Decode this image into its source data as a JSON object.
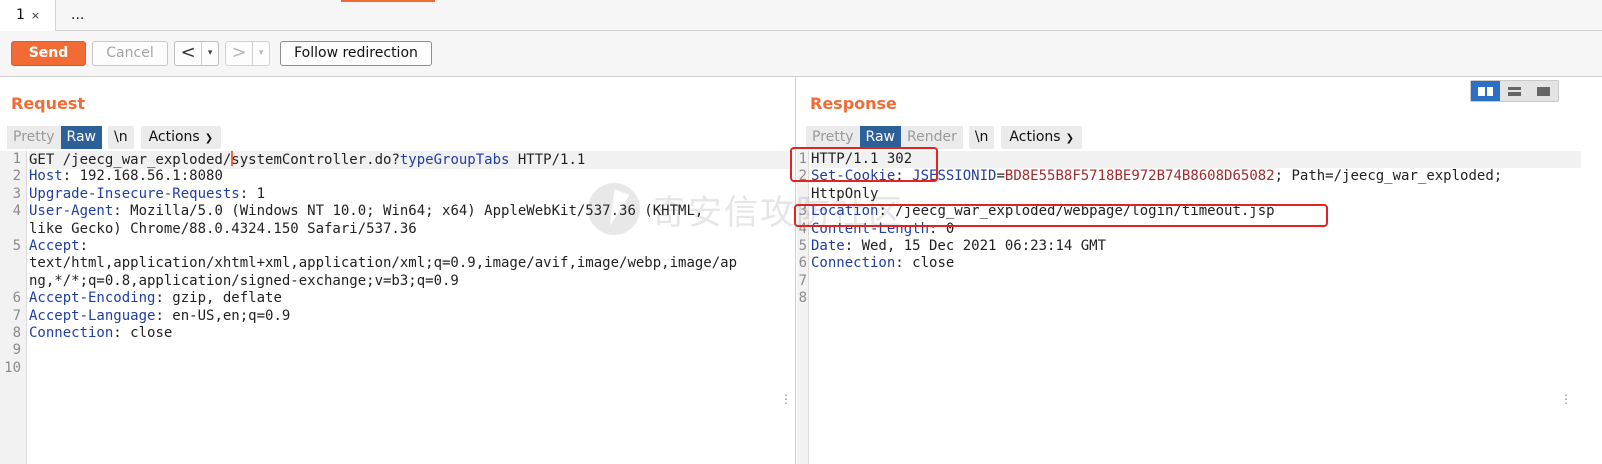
{
  "tabs": [
    {
      "label": "1",
      "close": "×"
    },
    {
      "label": "..."
    }
  ],
  "toolbar": {
    "send_label": "Send",
    "cancel_label": "Cancel",
    "back_arrow": "<",
    "forward_arrow": ">",
    "dropdown_glyph": "▾",
    "follow_label": "Follow redirection"
  },
  "request": {
    "title": "Request",
    "view_tabs": [
      "Pretty",
      "Raw"
    ],
    "selected_view": "Raw",
    "newline_toggle": "\\n",
    "actions_label": "Actions",
    "line_numbers": [
      "1",
      "2",
      "3",
      "4",
      "",
      "5",
      "",
      "",
      "6",
      "7",
      "8",
      "9",
      "10"
    ],
    "rows": [
      {
        "line": "1",
        "name": "",
        "sep": "",
        "value": "GET /jeecg_war_exploded/",
        "extra": "systemController.do?",
        "param": "typeGroupTabs",
        "tail": " HTTP/1.1"
      },
      {
        "line": "2",
        "name": "Host",
        "sep": ": ",
        "value": "192.168.56.1:8080"
      },
      {
        "line": "3",
        "name": "Upgrade-Insecure-Requests",
        "sep": ": ",
        "value": "1"
      },
      {
        "line": "4",
        "name": "User-Agent",
        "sep": ": ",
        "value": "Mozilla/5.0 (Windows NT 10.0; Win64; x64) AppleWebKit/537.36 (KHTML,"
      },
      {
        "line": "",
        "name": "",
        "sep": "",
        "value": "like Gecko) Chrome/88.0.4324.150 Safari/537.36"
      },
      {
        "line": "5",
        "name": "Accept",
        "sep": ":",
        "value": ""
      },
      {
        "line": "",
        "name": "",
        "sep": "",
        "value": "text/html,application/xhtml+xml,application/xml;q=0.9,image/avif,image/webp,image/ap"
      },
      {
        "line": "",
        "name": "",
        "sep": "",
        "value": "ng,*/*;q=0.8,application/signed-exchange;v=b3;q=0.9"
      },
      {
        "line": "6",
        "name": "Accept-Encoding",
        "sep": ": ",
        "value": "gzip, deflate"
      },
      {
        "line": "7",
        "name": "Accept-Language",
        "sep": ": ",
        "value": "en-US,en;q=0.9"
      },
      {
        "line": "8",
        "name": "Connection",
        "sep": ": ",
        "value": "close"
      },
      {
        "line": "9",
        "name": "",
        "sep": "",
        "value": ""
      },
      {
        "line": "10",
        "name": "",
        "sep": "",
        "value": ""
      }
    ]
  },
  "response": {
    "title": "Response",
    "view_tabs": [
      "Pretty",
      "Raw",
      "Render"
    ],
    "selected_view": "Raw",
    "newline_toggle": "\\n",
    "actions_label": "Actions",
    "rows": [
      {
        "line": "1",
        "name": "",
        "sep": "",
        "value": "HTTP/1.1 302"
      },
      {
        "line": "2",
        "name": "Set-Cookie",
        "sep": ": ",
        "cookie_name": "JSESSIONID",
        "cookie_eq": "=",
        "cookie_value": "BD8E55B8F5718BE972B74B8608D65082",
        "value": "; Path=/jeecg_war_exploded;"
      },
      {
        "line": "",
        "name": "",
        "sep": "",
        "value": "HttpOnly"
      },
      {
        "line": "3",
        "name": "Location",
        "sep": ": ",
        "value": "/jeecg_war_exploded/webpage/login/timeout.jsp"
      },
      {
        "line": "4",
        "name": "Content-Length",
        "sep": ": ",
        "value": "0"
      },
      {
        "line": "5",
        "name": "Date",
        "sep": ": ",
        "value": "Wed, 15 Dec 2021 06:23:14 GMT"
      },
      {
        "line": "6",
        "name": "Connection",
        "sep": ": ",
        "value": "close"
      },
      {
        "line": "7",
        "name": "",
        "sep": "",
        "value": ""
      },
      {
        "line": "8",
        "name": "",
        "sep": "",
        "value": ""
      }
    ]
  },
  "watermark": {
    "text": "奇安信攻防社区"
  },
  "colors": {
    "accent": "#f36b34",
    "selected_tab": "#2d5f99",
    "annotation": "#e5231c",
    "header_name": "#1f3fa3",
    "cookie_value": "#a32a2a"
  }
}
